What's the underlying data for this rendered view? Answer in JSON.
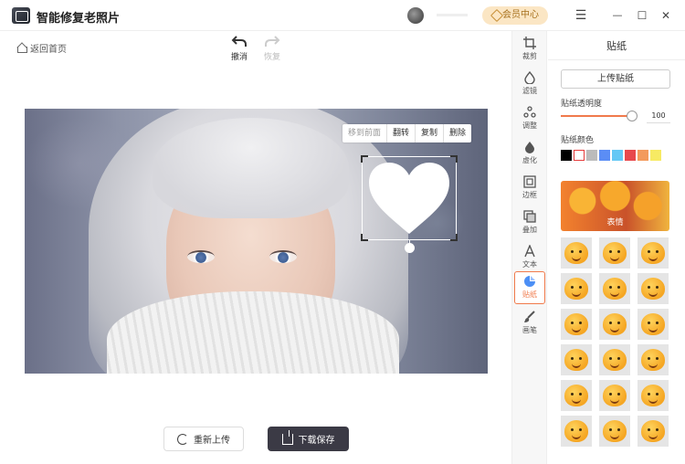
{
  "app": {
    "title": "智能修复老照片"
  },
  "header": {
    "vip_label": "会员中心",
    "min_glyph": "—",
    "max_glyph": "☐",
    "close_glyph": "✕",
    "menu_glyph": "☰"
  },
  "nav": {
    "back_home": "返回首页"
  },
  "history": {
    "undo": "撤消",
    "redo": "恢复"
  },
  "sticker_toolbar": [
    "移到前面",
    "翻转",
    "复制",
    "删除"
  ],
  "actions": {
    "reupload": "重新上传",
    "download": "下载保存"
  },
  "tools": [
    {
      "label": "裁剪",
      "icon": "crop-icon"
    },
    {
      "label": "滤镜",
      "icon": "filter-icon"
    },
    {
      "label": "调整",
      "icon": "adjust-icon"
    },
    {
      "label": "虚化",
      "icon": "blur-icon"
    },
    {
      "label": "边框",
      "icon": "frame-icon"
    },
    {
      "label": "叠加",
      "icon": "overlay-icon"
    },
    {
      "label": "文本",
      "icon": "text-icon"
    },
    {
      "label": "贴纸",
      "icon": "sticker-icon",
      "active": true
    },
    {
      "label": "画笔",
      "icon": "brush-icon"
    }
  ],
  "panel": {
    "title": "贴纸",
    "upload_label": "上传贴纸",
    "opacity_label": "贴纸透明度",
    "opacity_value": "100",
    "color_label": "贴纸颜色",
    "colors": [
      "#000000",
      "#ffffff",
      "#bbbbbb",
      "#5b8df5",
      "#65c8f5",
      "#e8484c",
      "#f39a5c",
      "#f7ea63"
    ],
    "selected_color": "#ffffff",
    "category_label": "表情",
    "emoji_count": 18
  },
  "colors": {
    "accent": "#f07a4b",
    "download_bg": "#3b3a45"
  }
}
